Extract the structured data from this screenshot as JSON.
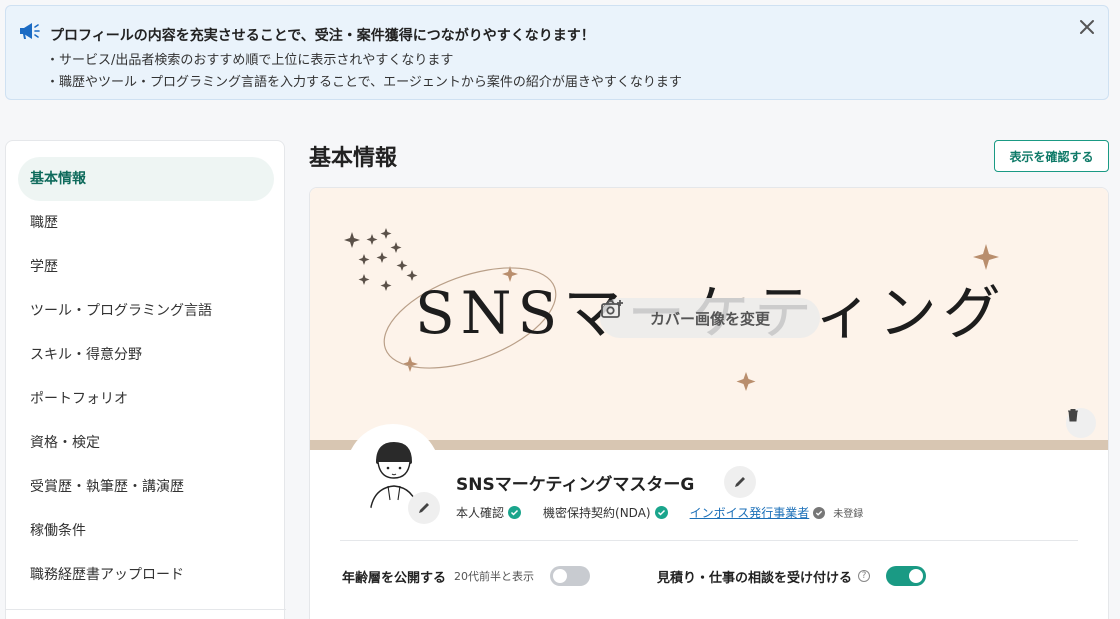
{
  "notice": {
    "title": "プロフィールの内容を充実させることで、受注・案件獲得につながりやすくなります！",
    "line1": "・サービス/出品者検索のおすすめ順で上位に表示されやすくなります",
    "line2": "・職歴やツール・プログラミング言語を入力することで、エージェントから案件の紹介が届きやすくなります",
    "icon": "megaphone-icon"
  },
  "sidebar": {
    "items": [
      {
        "label": "基本情報",
        "active": true
      },
      {
        "label": "職歴"
      },
      {
        "label": "学歴"
      },
      {
        "label": "ツール・プログラミング言語"
      },
      {
        "label": "スキル・得意分野"
      },
      {
        "label": "ポートフォリオ"
      },
      {
        "label": "資格・検定"
      },
      {
        "label": "受賞歴・執筆歴・講演歴"
      },
      {
        "label": "稼働条件"
      },
      {
        "label": "職務経歴書アップロード"
      }
    ]
  },
  "main": {
    "title": "基本情報",
    "confirm_button": "表示を確認する"
  },
  "cover": {
    "text": "SNSマーケティング",
    "change_label": "カバー画像を変更"
  },
  "profile": {
    "name": "SNSマーケティングマスターG",
    "identity": "本人確認",
    "nda": "機密保持契約(NDA)",
    "invoice": "インボイス発行事業者",
    "invoice_status": "未登録"
  },
  "settings": {
    "age_label": "年齢層を公開する",
    "age_sub": "20代前半と表示",
    "age_public": false,
    "consult_label": "見積り・仕事の相談を受け付ける",
    "consult_enabled": true
  },
  "colors": {
    "accent": "#1a9a84",
    "notice_bg": "#eaf3fb",
    "cover_bg": "#fdf3ea"
  }
}
